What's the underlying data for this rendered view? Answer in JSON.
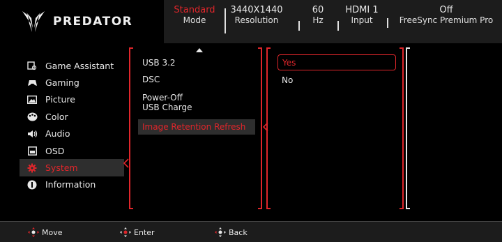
{
  "header": {
    "brand": "PREDATOR",
    "status": [
      {
        "value": "Standard",
        "label": "Mode",
        "active": true
      },
      {
        "value": "3440X1440",
        "label": "Resolution",
        "active": false
      },
      {
        "value": "60",
        "label": "Hz",
        "active": false
      },
      {
        "value": "HDMI 1",
        "label": "Input",
        "active": false
      },
      {
        "value": "Off",
        "label": "FreeSync Premium Pro",
        "active": false
      }
    ]
  },
  "sidebar": {
    "items": [
      {
        "label": "Game Assistant",
        "icon": "game-assistant-icon"
      },
      {
        "label": "Gaming",
        "icon": "gamepad-icon"
      },
      {
        "label": "Picture",
        "icon": "picture-icon"
      },
      {
        "label": "Color",
        "icon": "palette-icon"
      },
      {
        "label": "Audio",
        "icon": "speaker-icon"
      },
      {
        "label": "OSD",
        "icon": "osd-icon"
      },
      {
        "label": "System",
        "icon": "gear-icon",
        "active": true
      },
      {
        "label": "Information",
        "icon": "info-icon"
      }
    ]
  },
  "submenu": {
    "items": [
      {
        "label": "USB 3.2"
      },
      {
        "label": "DSC"
      },
      {
        "label": "Power-Off",
        "label2": "USB Charge"
      },
      {
        "label": "Image Retention Refresh",
        "active": true
      }
    ]
  },
  "options": {
    "items": [
      {
        "label": "Yes",
        "selected": true
      },
      {
        "label": "No",
        "selected": false
      }
    ]
  },
  "footer": {
    "move": "Move",
    "enter": "Enter",
    "back": "Back"
  },
  "colors": {
    "accent": "#e0262b",
    "panel": "#1c1c1c",
    "highlight": "#2e2e2e"
  }
}
